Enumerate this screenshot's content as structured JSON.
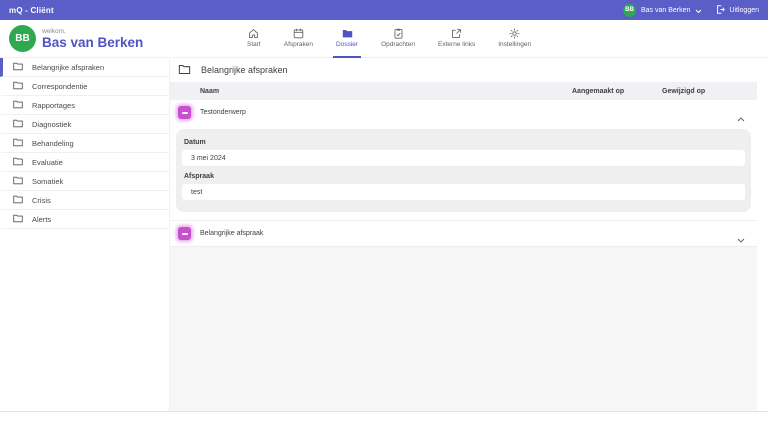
{
  "topbar": {
    "app_title": "mQ - Cliënt",
    "user": {
      "initials": "BB",
      "name": "Bas van Berken"
    },
    "logout_label": "Uitloggen"
  },
  "header": {
    "avatar_initials": "BB",
    "welcome_label": "welkom,",
    "user_name": "Bas van Berken",
    "nav": [
      {
        "label": "Start",
        "icon": "home-icon",
        "active": false
      },
      {
        "label": "Afspraken",
        "icon": "calendar-icon",
        "active": false
      },
      {
        "label": "Dossier",
        "icon": "folder-icon",
        "active": true
      },
      {
        "label": "Opdrachten",
        "icon": "clipboard-icon",
        "active": false
      },
      {
        "label": "Externe links",
        "icon": "external-link-icon",
        "active": false
      },
      {
        "label": "Instellingen",
        "icon": "gear-icon",
        "active": false
      }
    ]
  },
  "sidebar": {
    "items": [
      {
        "label": "Belangrijke afspraken",
        "icon": "folder-icon",
        "active": true
      },
      {
        "label": "Correspondentie",
        "icon": "folder-icon",
        "active": false
      },
      {
        "label": "Rapportages",
        "icon": "folder-icon",
        "active": false
      },
      {
        "label": "Diagnostiek",
        "icon": "folder-icon",
        "active": false
      },
      {
        "label": "Behandeling",
        "icon": "folder-icon",
        "active": false
      },
      {
        "label": "Evaluatie",
        "icon": "folder-icon",
        "active": false
      },
      {
        "label": "Somatiek",
        "icon": "folder-icon",
        "active": false
      },
      {
        "label": "Crisis",
        "icon": "folder-icon",
        "active": false
      },
      {
        "label": "Alerts",
        "icon": "folder-icon",
        "active": false
      }
    ]
  },
  "main": {
    "section_title": "Belangrijke afspraken",
    "table": {
      "columns": [
        "Naam",
        "Aangemaakt op",
        "Gewijzigd op"
      ]
    },
    "rows": [
      {
        "name": "Testonderwerp",
        "expanded": true,
        "fields": [
          {
            "label": "Datum",
            "value": "3 mei 2024"
          },
          {
            "label": "Afspraak",
            "value": "test"
          }
        ]
      },
      {
        "name": "Belangrijke afspraak",
        "expanded": false
      }
    ]
  },
  "colors": {
    "topbar_bg": "#5a5ec6",
    "accent": "#5053c4",
    "avatar_green": "#2fa84f",
    "topic_icon_magenta": "#c94fd1"
  }
}
